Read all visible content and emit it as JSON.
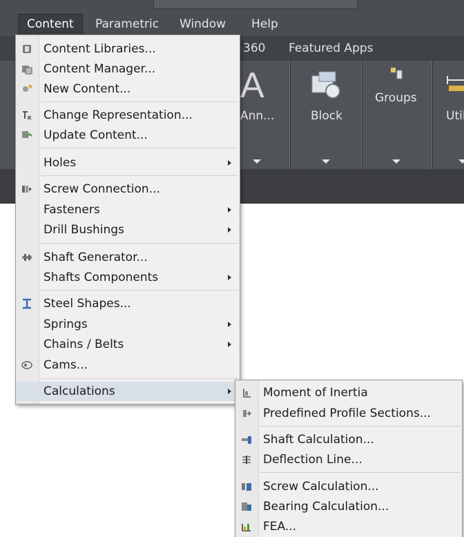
{
  "menubar": {
    "items": [
      {
        "label": "Content",
        "active": true
      },
      {
        "label": "Parametric"
      },
      {
        "label": "Window"
      },
      {
        "label": "Help"
      }
    ]
  },
  "ribbon": {
    "tabs": [
      "360",
      "Featured Apps"
    ],
    "panels": [
      {
        "label": "Ann...",
        "icon": "annotation-A-icon"
      },
      {
        "label": "Block",
        "icon": "block-icon"
      },
      {
        "label": "Groups",
        "icon": "groups-icon"
      },
      {
        "label": "Util",
        "icon": "utilities-measure-icon"
      }
    ]
  },
  "content_menu": {
    "items": [
      {
        "label": "Content Libraries...",
        "icon": "content-libraries-icon"
      },
      {
        "label": "Content Manager...",
        "icon": "content-manager-icon"
      },
      {
        "label": "New Content...",
        "icon": "new-content-icon"
      },
      {
        "label": "Change Representation...",
        "icon": "change-representation-icon"
      },
      {
        "label": "Update Content...",
        "icon": "update-content-icon"
      },
      {
        "label": "Holes",
        "submenu": true
      },
      {
        "label": "Screw Connection...",
        "icon": "screw-connection-icon"
      },
      {
        "label": "Fasteners",
        "submenu": true
      },
      {
        "label": "Drill Bushings",
        "submenu": true
      },
      {
        "label": "Shaft Generator...",
        "icon": "shaft-generator-icon"
      },
      {
        "label": "Shafts Components",
        "submenu": true
      },
      {
        "label": "Steel Shapes...",
        "icon": "steel-shapes-icon"
      },
      {
        "label": "Springs",
        "submenu": true
      },
      {
        "label": "Chains / Belts",
        "submenu": true
      },
      {
        "label": "Cams...",
        "icon": "cams-icon"
      },
      {
        "label": "Calculations",
        "submenu": true,
        "selected": true
      }
    ]
  },
  "calculations_menu": {
    "items": [
      {
        "label": "Moment of Inertia",
        "icon": "moment-of-inertia-icon"
      },
      {
        "label": "Predefined Profile Sections...",
        "icon": "profile-sections-icon"
      },
      {
        "label": "Shaft Calculation...",
        "icon": "shaft-calculation-icon"
      },
      {
        "label": "Deflection Line...",
        "icon": "deflection-line-icon"
      },
      {
        "label": "Screw Calculation...",
        "icon": "screw-calculation-icon"
      },
      {
        "label": "Bearing Calculation...",
        "icon": "bearing-calculation-icon"
      },
      {
        "label": "FEA...",
        "icon": "fea-icon"
      }
    ]
  },
  "colors": {
    "menubar": "#4a4d51",
    "ribbon": "#505357",
    "menu_bg": "#f0f0f0",
    "menu_selected": "#d9dfe7"
  }
}
